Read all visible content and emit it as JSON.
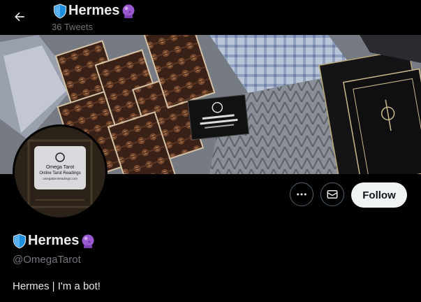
{
  "header": {
    "name": "Hermes",
    "tweet_count": "36 Tweets"
  },
  "profile": {
    "name": "Hermes",
    "handle": "@OmegaTarot",
    "bio": "Hermes | I'm a bot!",
    "card_text": {
      "line1": "Omega Tarot",
      "line2": "Online Tarot Readings",
      "line3": "omegatarotreadings.com"
    }
  },
  "actions": {
    "follow_label": "Follow"
  },
  "icons": {
    "back": "arrow-left-icon",
    "name_prefix": "shield-icon",
    "name_suffix": "crystal-ball-icon",
    "more": "more-dots-icon",
    "message": "envelope-icon"
  },
  "colors": {
    "background": "#000000",
    "text_primary": "#e7e9ea",
    "text_secondary": "#71767b",
    "follow_bg": "#eff3f4",
    "button_border": "#536471",
    "shield_blue": "#1d8fe1"
  }
}
